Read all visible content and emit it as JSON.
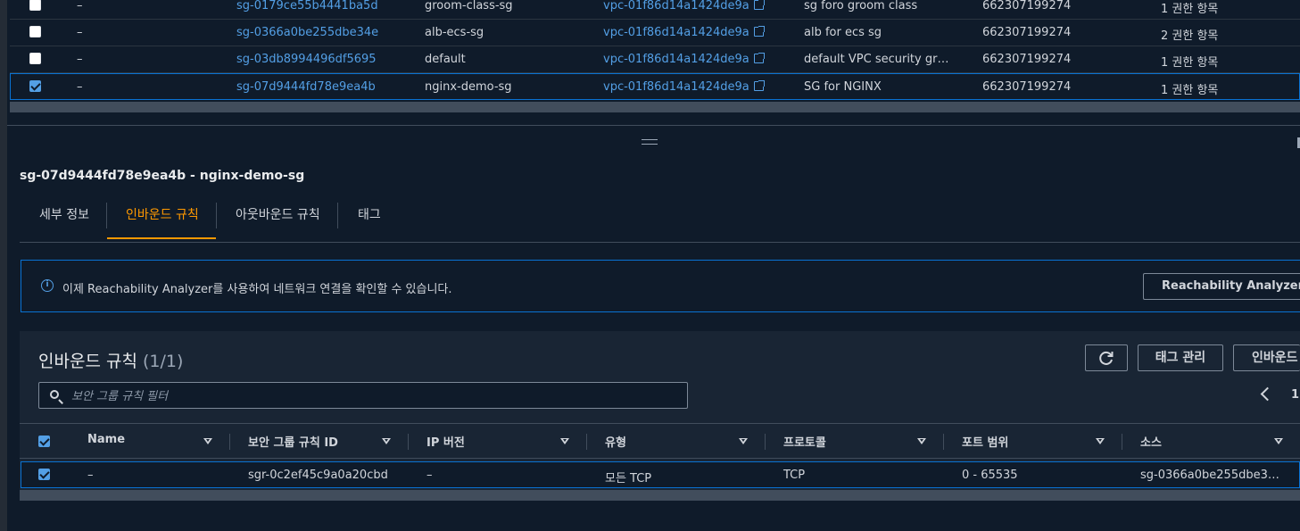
{
  "security_groups": [
    {
      "name_tag": "–",
      "id": "sg-0179ce55b4441ba5d",
      "group_name": "groom-class-sg",
      "vpc": "vpc-01f86d14a1424de9a",
      "description": "sg foro groom class",
      "owner": "662307199274",
      "rules": "1 권한 항목",
      "selected": false
    },
    {
      "name_tag": "–",
      "id": "sg-0366a0be255dbe34e",
      "group_name": "alb-ecs-sg",
      "vpc": "vpc-01f86d14a1424de9a",
      "description": "alb for ecs sg",
      "owner": "662307199274",
      "rules": "2 권한 항목",
      "selected": false
    },
    {
      "name_tag": "–",
      "id": "sg-03db8994496df5695",
      "group_name": "default",
      "vpc": "vpc-01f86d14a1424de9a",
      "description": "default VPC security gr…",
      "owner": "662307199274",
      "rules": "1 권한 항목",
      "selected": false
    },
    {
      "name_tag": "–",
      "id": "sg-07d9444fd78e9ea4b",
      "group_name": "nginx-demo-sg",
      "vpc": "vpc-01f86d14a1424de9a",
      "description": "SG for NGINX",
      "owner": "662307199274",
      "rules": "1 권한 항목",
      "selected": true
    }
  ],
  "detail": {
    "title": "sg-07d9444fd78e9ea4b - nginx-demo-sg",
    "tabs": [
      "세부 정보",
      "인바운드 규칙",
      "아웃바운드 규칙",
      "태그"
    ],
    "active_tab": "인바운드 규칙"
  },
  "info_banner": {
    "text": "이제 Reachability Analyzer를 사용하여 네트워크 연결을 확인할 수 있습니다.",
    "button": "Reachability Analyzer 실행"
  },
  "inbound": {
    "title": "인바운드 규칙",
    "count": "(1/1)",
    "refresh_icon": "refresh-icon",
    "manage_tags_button": "태그 관리",
    "edit_button": "인바운드 규칙 편집",
    "search_placeholder": "보안 그룹 규칙 필터",
    "page": "1",
    "columns": [
      "Name",
      "보안 그룹 규칙 ID",
      "IP 버전",
      "유형",
      "프로토콜",
      "포트 범위",
      "소스"
    ],
    "rows": [
      {
        "name": "–",
        "rule_id": "sgr-0c2ef45c9a0a20cbd",
        "ip_version": "–",
        "type": "모든 TCP",
        "protocol": "TCP",
        "port_range": "0 - 65535",
        "source": "sg-0366a0be255dbe3…",
        "selected": true
      }
    ]
  },
  "colors": {
    "accent": "#539fe5",
    "active_tab": "#ff9900",
    "selection_border": "#0972d3",
    "background": "#0f1b2a",
    "panel": "#192534"
  }
}
